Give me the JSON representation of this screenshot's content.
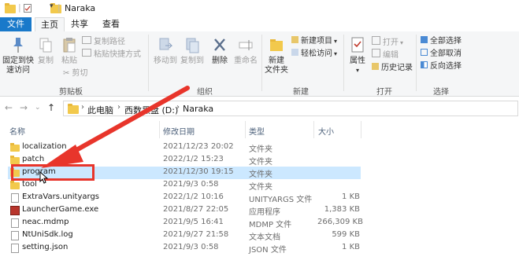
{
  "window": {
    "title": "Naraka"
  },
  "tabs": [
    "文件",
    "主页",
    "共享",
    "查看"
  ],
  "ribbon": {
    "clipboard": {
      "pin": "固定到快\n速访问",
      "copy": "复制",
      "paste": "粘贴",
      "copy_path": "复制路径",
      "paste_shortcut": "粘贴快捷方式",
      "cut": "剪切",
      "label": "剪贴板"
    },
    "organize": {
      "move_to": "移动到",
      "copy_to": "复制到",
      "delete": "删除",
      "rename": "重命名",
      "label": "组织"
    },
    "new": {
      "new_folder": "新建\n文件夹",
      "new_item": "新建项目",
      "easy_access": "轻松访问",
      "label": "新建"
    },
    "open": {
      "properties": "属性",
      "open": "打开",
      "edit": "编辑",
      "history": "历史记录",
      "label": "打开"
    },
    "select": {
      "select_all": "全部选择",
      "select_none": "全部取消",
      "invert": "反向选择",
      "label": "选择"
    }
  },
  "address": {
    "crumbs": [
      "此电脑",
      "西数黑盘 (D:)",
      "Naraka"
    ]
  },
  "columns": {
    "name": "名称",
    "date": "修改日期",
    "type": "类型",
    "size": "大小"
  },
  "files": [
    {
      "name": "localization",
      "date": "2021/12/23 20:02",
      "type": "文件夹",
      "size": "",
      "icon": "folder-icon"
    },
    {
      "name": "patch",
      "date": "2022/1/2 15:23",
      "type": "文件夹",
      "size": "",
      "icon": "folder-icon"
    },
    {
      "name": "program",
      "date": "2021/12/30 19:15",
      "type": "文件夹",
      "size": "",
      "icon": "folder-icon"
    },
    {
      "name": "tool",
      "date": "2021/9/3 0:58",
      "type": "文件夹",
      "size": "",
      "icon": "folder-icon"
    },
    {
      "name": "ExtraVars.unityargs",
      "date": "2022/1/2 10:16",
      "type": "UNITYARGS 文件",
      "size": "1 KB",
      "icon": "file-icon"
    },
    {
      "name": "LauncherGame.exe",
      "date": "2021/8/27 22:05",
      "type": "应用程序",
      "size": "1,383 KB",
      "icon": "exe-icon"
    },
    {
      "name": "neac.mdmp",
      "date": "2021/9/5 16:41",
      "type": "MDMP 文件",
      "size": "266,309 KB",
      "icon": "file-icon"
    },
    {
      "name": "NtUniSdk.log",
      "date": "2021/9/27 21:58",
      "type": "文本文档",
      "size": "599 KB",
      "icon": "file-icon"
    },
    {
      "name": "setting.json",
      "date": "2021/9/3 0:58",
      "type": "JSON 文件",
      "size": "1 KB",
      "icon": "file-icon"
    }
  ],
  "colors": {
    "accent": "#1979ca",
    "selected_row": "#cce8ff",
    "annotation": "#e8352b",
    "folder": "#f2c94c"
  }
}
